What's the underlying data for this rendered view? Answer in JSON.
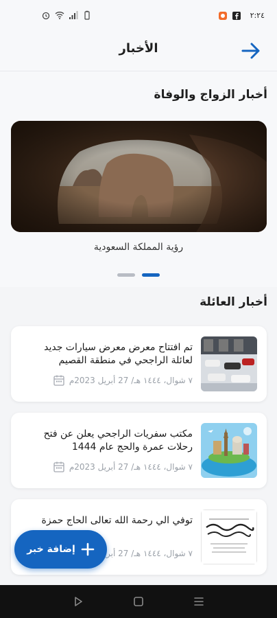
{
  "status_bar": {
    "time": "٢:٢٤",
    "icons": [
      "facebook-icon",
      "app-notification-icon",
      "battery-icon",
      "signal-icon",
      "wifi-icon",
      "alarm-icon"
    ]
  },
  "header": {
    "title": "الأخبار",
    "back_icon": "arrow-right-icon"
  },
  "marriage_section": {
    "title": "أخبار الزواج والوفاة",
    "slide_caption": "رؤية المملكة السعودية",
    "slides_count": 2,
    "active_slide": 2
  },
  "family_section": {
    "title": "أخبار العائلة",
    "items": [
      {
        "headline": "تم افتتاح معرض معرض سيارات جديد لعائلة الراجحي في منطقة القصيم",
        "date": "٧ شوال، ١٤٤٤ هـ/ 27 أبريل 2023م",
        "thumb": "car-showroom"
      },
      {
        "headline": "مكتب سفريات الراجحي يعلن عن فتح رحلات عمرة والحج عام 1444",
        "date": "٧ شوال، ١٤٤٤ هـ/ 27 أبريل 2023م",
        "thumb": "travel-collage"
      },
      {
        "headline": "توفي الي رحمة الله تعالى الحاج حمزة",
        "date": "٧ شوال، ١٤٤٤ هـ/ 27 أبريل 2023م",
        "thumb": "condolence-card"
      }
    ]
  },
  "fab": {
    "label": "إضافة خبر",
    "icon": "plus-icon"
  },
  "colors": {
    "primary": "#1565c0",
    "background": "#f4f5f7",
    "text_muted": "#9aa0a8"
  }
}
